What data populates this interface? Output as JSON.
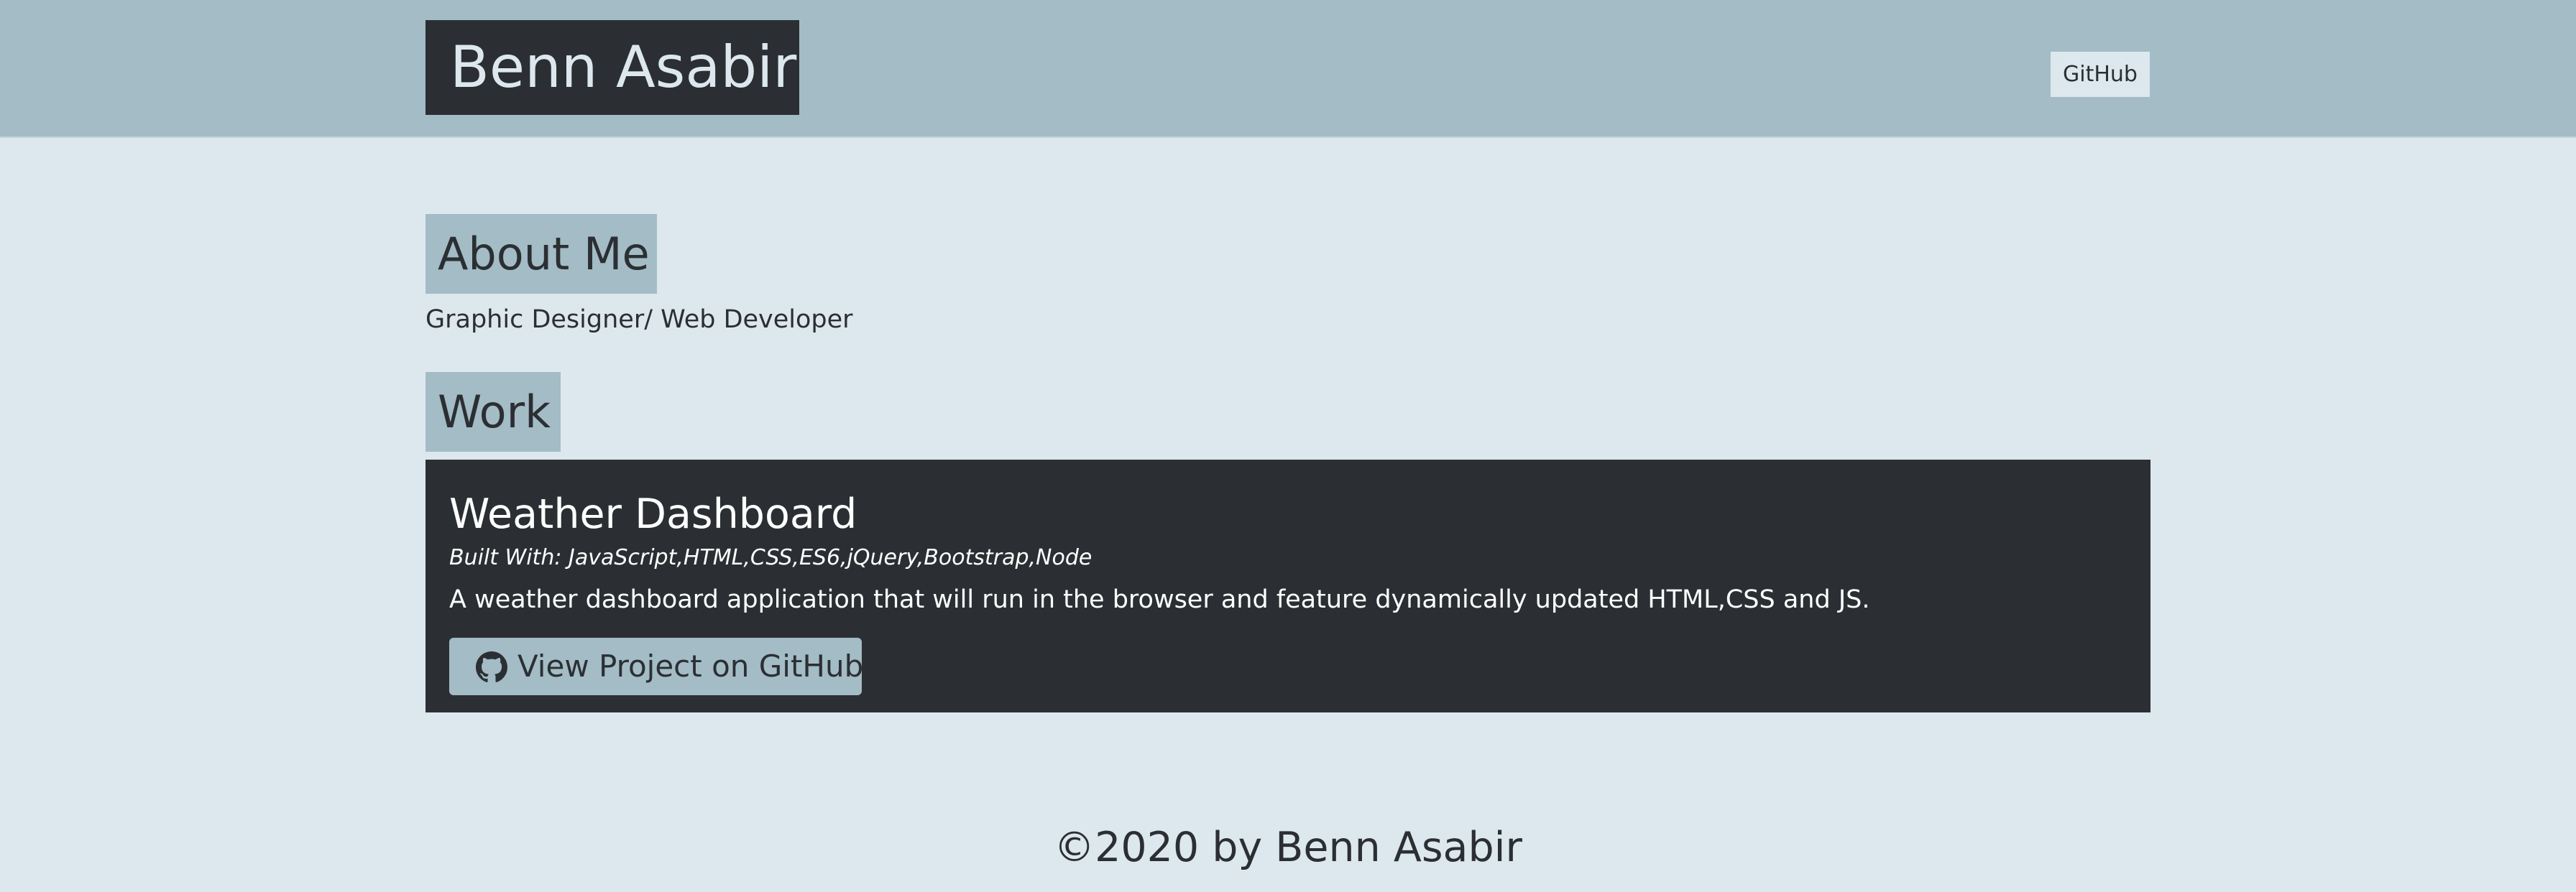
{
  "header": {
    "brand": "Benn Asabir",
    "nav_link": "GitHub"
  },
  "about": {
    "heading": "About Me",
    "text": "Graphic Designer/ Web Developer"
  },
  "work": {
    "heading": "Work",
    "projects": [
      {
        "title": "Weather Dashboard",
        "tech": "Built With: JavaScript,HTML,CSS,ES6,jQuery,Bootstrap,Node",
        "description": "A weather dashboard application that will run in the browser and feature dynamically updated HTML,CSS and JS.",
        "button_label": "View Project on GitHub",
        "button_icon": "github-icon"
      }
    ]
  },
  "footer": {
    "text": "©2020 by Benn Asabir"
  },
  "colors": {
    "header_bg": "#a3bcc6",
    "page_bg": "#dde8ee",
    "dark": "#2b2f33"
  }
}
